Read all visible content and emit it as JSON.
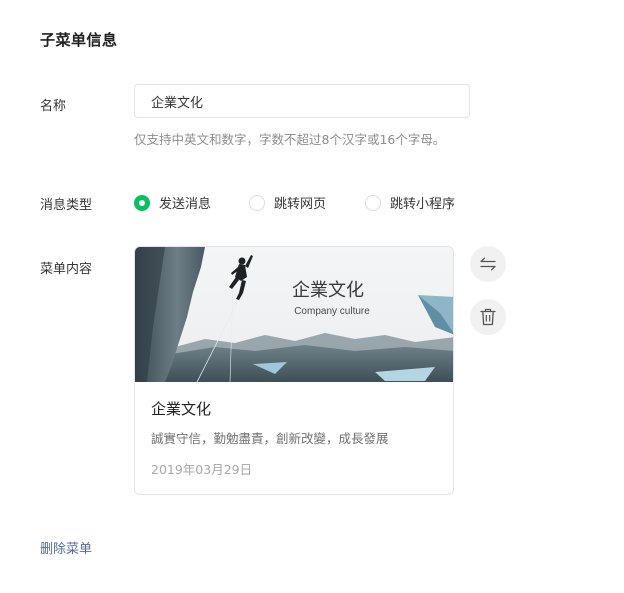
{
  "section": {
    "title": "子菜单信息"
  },
  "name_row": {
    "label": "名称",
    "input_value": "企業文化",
    "hint": "仅支持中英文和数字，字数不超过8个汉字或16个字母。"
  },
  "type_row": {
    "label": "消息类型",
    "options": [
      {
        "label": "发送消息",
        "checked": true
      },
      {
        "label": "跳转网页",
        "checked": false
      },
      {
        "label": "跳转小程序",
        "checked": false
      }
    ]
  },
  "content_row": {
    "label": "菜单内容",
    "card": {
      "cover_title": "企業文化",
      "cover_subtitle": "Company culture",
      "title": "企業文化",
      "description": "誠實守信，勤勉盡責，創新改變，成長發展",
      "date": "2019年03月29日"
    },
    "actions": {
      "switch_icon": "swap-arrows-icon",
      "delete_icon": "trash-icon"
    }
  },
  "footer": {
    "delete_menu_label": "删除菜单"
  },
  "colors": {
    "accent_green": "#07c160",
    "link_blue": "#576b95"
  }
}
